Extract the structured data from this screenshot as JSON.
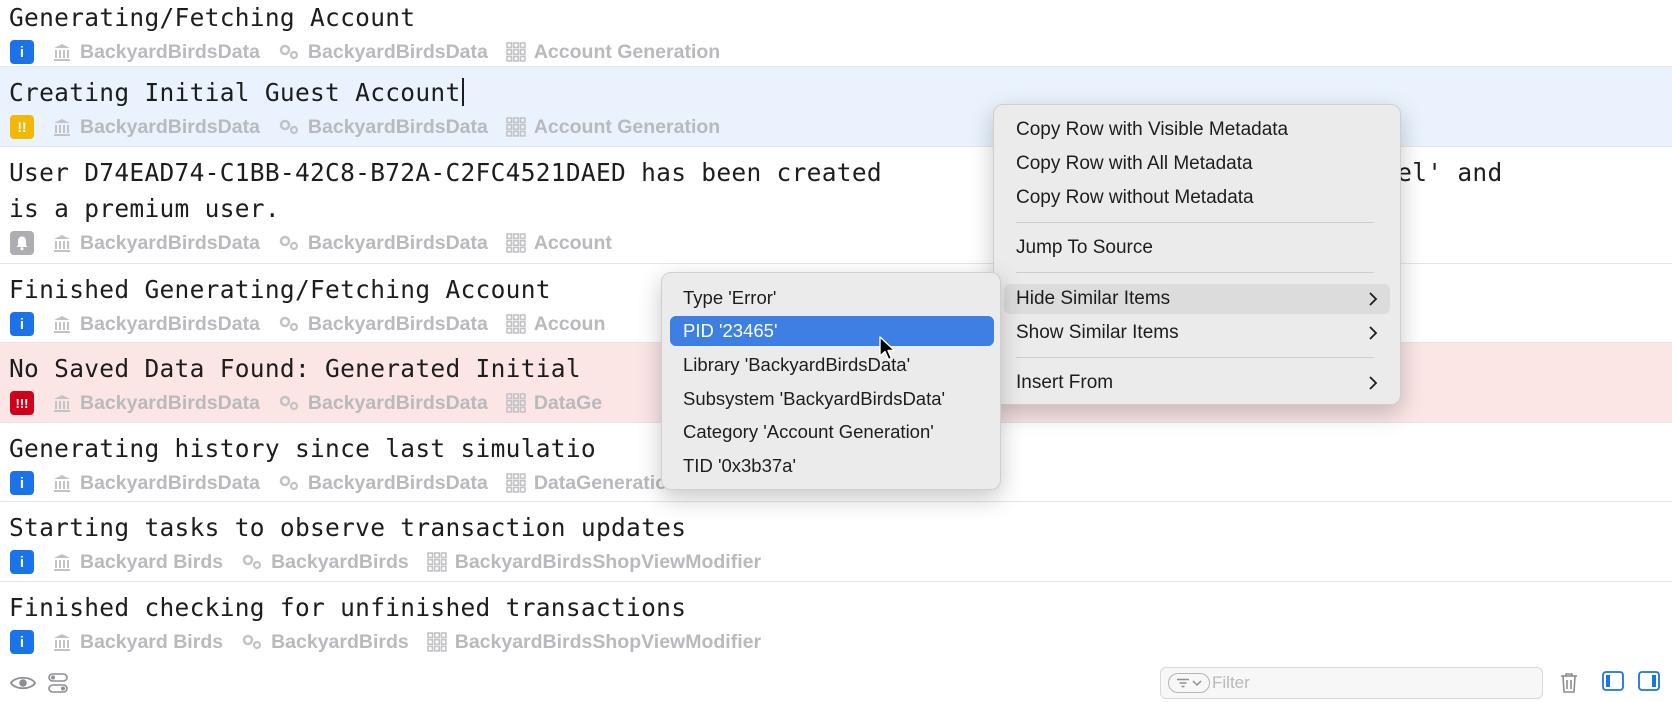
{
  "rows": [
    {
      "message": "Generating/Fetching Account",
      "level": "info",
      "badge": "i",
      "library": "BackyardBirdsData",
      "subsystem": "BackyardBirdsData",
      "category": "Account Generation"
    },
    {
      "message": "Creating Initial Guest Account",
      "level": "error",
      "badge": "!!",
      "library": "BackyardBirdsData",
      "subsystem": "BackyardBirdsData",
      "category": "Account Generation"
    },
    {
      "message": "User D74EAD74-C1BB-42C8-B72A-C2FC4521DAED has been created",
      "message_tail": "Patel' and",
      "message_line2": "is a premium user.",
      "level": "notice",
      "badge": "bell",
      "library": "BackyardBirdsData",
      "subsystem": "BackyardBirdsData",
      "category": "Account"
    },
    {
      "message": "Finished Generating/Fetching Account",
      "level": "info",
      "badge": "i",
      "library": "BackyardBirdsData",
      "subsystem": "BackyardBirdsData",
      "category": "Accoun"
    },
    {
      "message": "No Saved Data Found: Generated Initial",
      "level": "fault",
      "badge": "!!!",
      "library": "BackyardBirdsData",
      "subsystem": "BackyardBirdsData",
      "category": "DataGe"
    },
    {
      "message": "Generating history since last simulatio",
      "level": "info",
      "badge": "i",
      "library": "BackyardBirdsData",
      "subsystem": "BackyardBirdsData",
      "category": "DataGeneration"
    },
    {
      "message": "Starting tasks to observe transaction updates",
      "level": "info",
      "badge": "i",
      "library": "Backyard Birds",
      "subsystem": "BackyardBirds",
      "category": "BackyardBirdsShopViewModifier"
    },
    {
      "message": "Finished checking for unfinished transactions",
      "level": "info",
      "badge": "i",
      "library": "Backyard Birds",
      "subsystem": "BackyardBirds",
      "category": "BackyardBirdsShopViewModifier"
    }
  ],
  "context_menu": {
    "items": [
      "Copy Row with Visible Metadata",
      "Copy Row with All Metadata",
      "Copy Row without Metadata",
      "Jump To Source",
      "Hide Similar Items",
      "Show Similar Items",
      "Insert From"
    ]
  },
  "submenu": {
    "items": [
      "Type 'Error'",
      "PID '23465'",
      "Library 'BackyardBirdsData'",
      "Subsystem 'BackyardBirdsData'",
      "Category 'Account Generation'",
      "TID '0x3b37a'"
    ],
    "highlighted": "PID '23465'"
  },
  "bottom_bar": {
    "filter_placeholder": "Filter"
  },
  "colors": {
    "info": "#1a73e8",
    "error": "#f2b807",
    "fault": "#d0021b",
    "notice": "#aeaeb2",
    "selected_row": "#e9f2fd",
    "fault_row": "#fbe5e5",
    "menu_highlight": "#3e7fe3"
  }
}
